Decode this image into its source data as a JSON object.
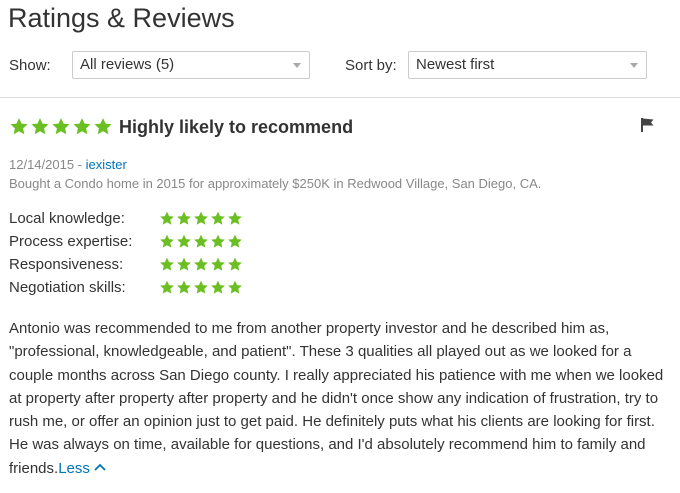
{
  "page": {
    "title": "Ratings & Reviews"
  },
  "filters": {
    "show_label": "Show:",
    "show_value": "All reviews (5)",
    "sort_label": "Sort by:",
    "sort_value": "Newest first"
  },
  "colors": {
    "star": "#6bbf22",
    "link": "#0074b7",
    "text": "#333333",
    "muted": "#888888"
  },
  "review": {
    "overall_rating": 5,
    "headline": "Highly likely to recommend",
    "flag_icon": "flag-icon",
    "date": "12/14/2015",
    "separator": " - ",
    "author": "iexister",
    "transaction": "Bought a Condo home in 2015 for approximately $250K in Redwood Village, San Diego, CA.",
    "sub_ratings": [
      {
        "label": "Local knowledge:",
        "rating": 5
      },
      {
        "label": "Process expertise:",
        "rating": 5
      },
      {
        "label": "Responsiveness:",
        "rating": 5
      },
      {
        "label": "Negotiation skills:",
        "rating": 5
      }
    ],
    "text": "Antonio was recommended to me from another property investor and he described him as, \"professional, knowledgeable, and patient\". These 3 qualities all played out as we looked for a couple months across San Diego county. I really appreciated his patience with me when we looked at property after property after property and he didn't once show any indication of frustration, try to rush me, or offer an opinion just to get paid. He definitely puts what his clients are looking for first. He was always on time, available for questions, and I'd absolutely recommend him to family and friends.",
    "less_label": "Less"
  }
}
